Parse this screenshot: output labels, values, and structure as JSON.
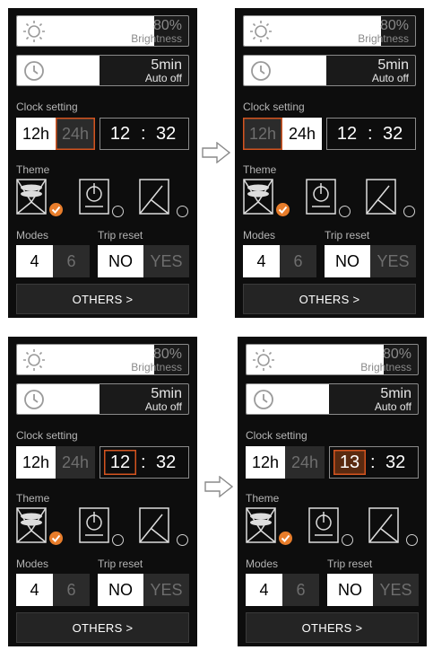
{
  "screens": [
    {
      "brightness": {
        "value": "80%",
        "label": "Brightness"
      },
      "auto_off": {
        "value": "5min",
        "label": "Auto off"
      },
      "clock": {
        "label": "Clock setting",
        "opt12": "12h",
        "opt24": "24h",
        "hour": "12",
        "sep": ":",
        "minute": "32"
      },
      "theme": {
        "label": "Theme"
      },
      "modes": {
        "label": "Modes",
        "opt1": "4",
        "opt2": "6"
      },
      "trip": {
        "label": "Trip reset",
        "no": "NO",
        "yes": "YES"
      },
      "others": "OTHERS >"
    },
    {
      "brightness": {
        "value": "80%",
        "label": "Brightness"
      },
      "auto_off": {
        "value": "5min",
        "label": "Auto off"
      },
      "clock": {
        "label": "Clock setting",
        "opt12": "12h",
        "opt24": "24h",
        "hour": "12",
        "sep": ":",
        "minute": "32"
      },
      "theme": {
        "label": "Theme"
      },
      "modes": {
        "label": "Modes",
        "opt1": "4",
        "opt2": "6"
      },
      "trip": {
        "label": "Trip reset",
        "no": "NO",
        "yes": "YES"
      },
      "others": "OTHERS >"
    },
    {
      "brightness": {
        "value": "80%",
        "label": "Brightness"
      },
      "auto_off": {
        "value": "5min",
        "label": "Auto off"
      },
      "clock": {
        "label": "Clock setting",
        "opt12": "12h",
        "opt24": "24h",
        "hour": "12",
        "sep": ":",
        "minute": "32"
      },
      "theme": {
        "label": "Theme"
      },
      "modes": {
        "label": "Modes",
        "opt1": "4",
        "opt2": "6"
      },
      "trip": {
        "label": "Trip reset",
        "no": "NO",
        "yes": "YES"
      },
      "others": "OTHERS >"
    },
    {
      "brightness": {
        "value": "80%",
        "label": "Brightness"
      },
      "auto_off": {
        "value": "5min",
        "label": "Auto off"
      },
      "clock": {
        "label": "Clock setting",
        "opt12": "12h",
        "opt24": "24h",
        "hour": "13",
        "sep": ":",
        "minute": "32"
      },
      "theme": {
        "label": "Theme"
      },
      "modes": {
        "label": "Modes",
        "opt1": "4",
        "opt2": "6"
      },
      "trip": {
        "label": "Trip reset",
        "no": "NO",
        "yes": "YES"
      },
      "others": "OTHERS >"
    }
  ],
  "accent_color": "#e87d2b",
  "outline_color": "#d4541f",
  "icons": [
    "sun-icon",
    "clock-icon",
    "theme-icon-1",
    "theme-icon-2",
    "theme-icon-3",
    "check-icon",
    "arrow-right-icon"
  ]
}
